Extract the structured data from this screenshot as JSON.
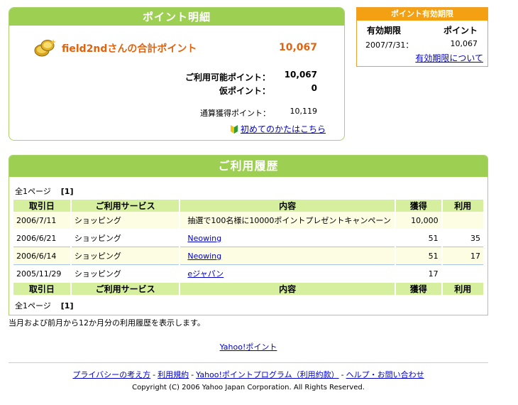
{
  "summary": {
    "title": "ポイント明細",
    "total_label": "field2ndさんの合計ポイント",
    "total_value": "10,067",
    "available_label": "ご利用可能ポイント：",
    "available_value": "10,067",
    "provisional_label": "仮ポイント：",
    "provisional_value": "0",
    "earned_label": "通算獲得ポイント：",
    "earned_value": "10,119",
    "beginner_link": "初めてのかたはこちら"
  },
  "expiry": {
    "title": "ポイント有効期限",
    "col_period": "有効期限",
    "col_points": "ポイント",
    "date": "2007/7/31：",
    "points": "10,067",
    "link": "有効期限について"
  },
  "history": {
    "title": "ご利用履歴",
    "pager_label": "全1ページ",
    "pager_page": "[1]",
    "columns": [
      "取引日",
      "ご利用サービス",
      "内容",
      "獲得",
      "利用"
    ],
    "rows": [
      {
        "date": "2006/7/11",
        "service": "ショッピング",
        "content": "抽選で100名様に10000ポイントプレゼントキャンペーン",
        "earned": "10,000",
        "used": ""
      },
      {
        "date": "2006/6/21",
        "service": "ショッピング",
        "content": "Neowing",
        "earned": "51",
        "used": "35"
      },
      {
        "date": "2006/6/14",
        "service": "ショッピング",
        "content": "Neowing",
        "earned": "51",
        "used": "17"
      },
      {
        "date": "2005/11/29",
        "service": "ショッピング",
        "content": "eジャパン",
        "earned": "17",
        "used": ""
      }
    ]
  },
  "note": "当月および前月から12か月分の利用履歴を表示します。",
  "yahoo_point_link": "Yahoo!ポイント",
  "footer": {
    "privacy": "プライバシーの考え方",
    "terms": "利用規約",
    "program": "Yahoo!ポイントプログラム（利用約款）",
    "help": "ヘルプ・お問い合わせ",
    "separator": "-",
    "copyright": "Copyright (C) 2006 Yahoo Japan Corporation. All Rights Reserved."
  },
  "colors": {
    "header_green": "#9dd052",
    "expiry_orange": "#f3a012",
    "total_orange": "#e2630e",
    "table_header": "#d6ef9e",
    "link_blue": "#0000cc"
  },
  "icons": [
    "coin-icon",
    "beginner-mark-icon"
  ]
}
